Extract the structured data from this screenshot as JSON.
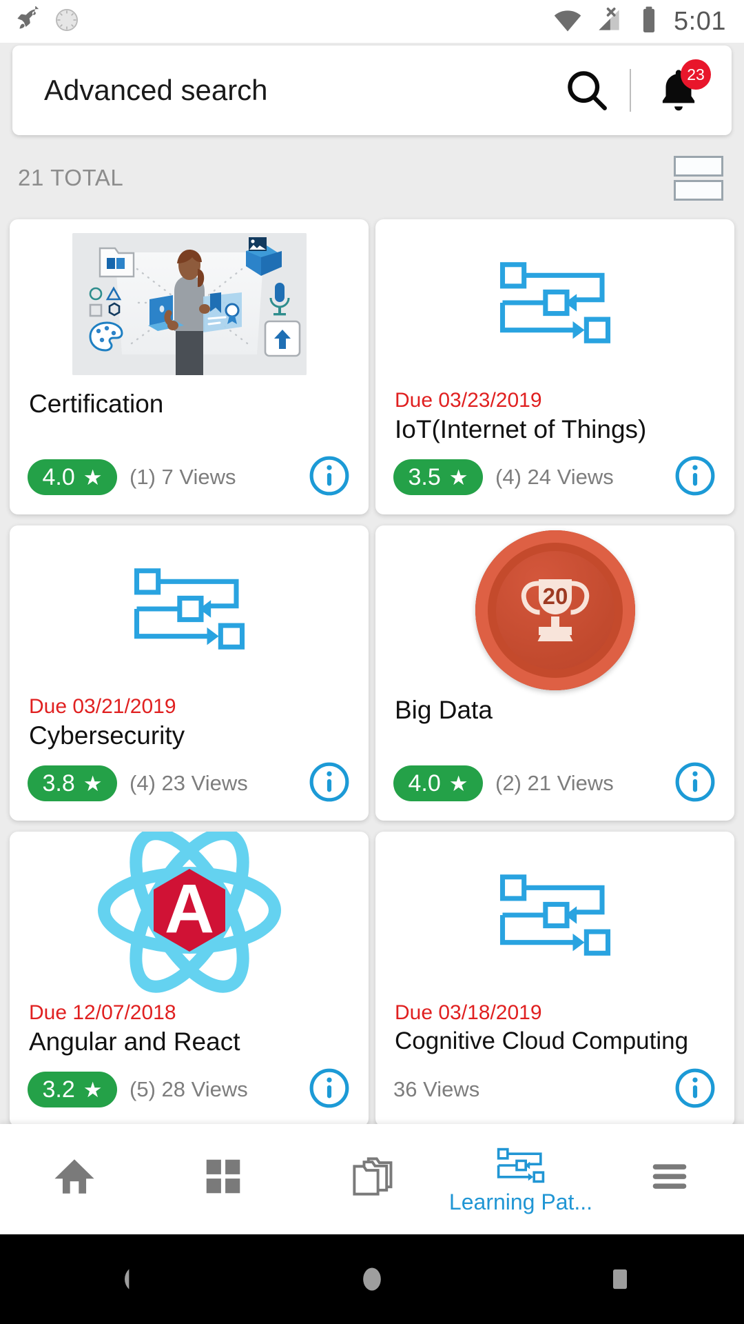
{
  "status_bar": {
    "left_icons": [
      "rocket-icon",
      "clock-sync-icon"
    ],
    "right_icons": [
      "wifi-icon",
      "cellular-no-signal-icon",
      "battery-icon"
    ],
    "time": "5:01"
  },
  "search": {
    "value": "Advanced search",
    "placeholder": "Advanced search",
    "search_icon": "search-icon",
    "bell_icon": "notification-bell-icon",
    "notification_count": "23"
  },
  "toolbar": {
    "total_label": "21 TOTAL",
    "view_toggle_icon": "list-view-toggle-icon"
  },
  "colors": {
    "rating_green": "#24A148",
    "due_red": "#E02020",
    "badge_red": "#E8162B",
    "accent_blue": "#2196D4",
    "info_blue": "#1C9AD6",
    "page_bg": "#ECECEC"
  },
  "cards": [
    {
      "media": "certification-illustration",
      "due": null,
      "title": "Certification",
      "rating": "4.0",
      "rating_count": "(1)",
      "views": "7 Views",
      "info_icon": "info-icon"
    },
    {
      "media": "learning-path-icon",
      "due": "Due 03/23/2019",
      "title": "IoT(Internet of Things)",
      "rating": "3.5",
      "rating_count": "(4)",
      "views": "24 Views",
      "info_icon": "info-icon"
    },
    {
      "media": "learning-path-icon",
      "due": "Due 03/21/2019",
      "title": "Cybersecurity",
      "rating": "3.8",
      "rating_count": "(4)",
      "views": "23 Views",
      "info_icon": "info-icon"
    },
    {
      "media": "trophy-badge",
      "trophy_number": "20",
      "due": null,
      "title": "Big Data",
      "rating": "4.0",
      "rating_count": "(2)",
      "views": "21 Views",
      "info_icon": "info-icon"
    },
    {
      "media": "angular-react-logo",
      "logo_letter": "A",
      "due": "Due 12/07/2018",
      "title": "Angular and React",
      "rating": "3.2",
      "rating_count": "(5)",
      "views": "28 Views",
      "info_icon": "info-icon"
    },
    {
      "media": "learning-path-icon",
      "due": "Due 03/18/2019",
      "title": "Cognitive Cloud Computing",
      "rating": null,
      "rating_count": null,
      "views": "36 Views",
      "info_icon": "info-icon"
    }
  ],
  "bottom_nav": [
    {
      "icon": "home-icon",
      "label": "",
      "active": false
    },
    {
      "icon": "grid-icon",
      "label": "",
      "active": false
    },
    {
      "icon": "folders-icon",
      "label": "",
      "active": false
    },
    {
      "icon": "learning-path-icon",
      "label": "Learning Pat...",
      "active": true
    },
    {
      "icon": "hamburger-menu-icon",
      "label": "",
      "active": false
    }
  ],
  "system_nav": {
    "back": "back-triangle-icon",
    "home": "home-circle-icon",
    "recents": "recents-square-icon"
  }
}
